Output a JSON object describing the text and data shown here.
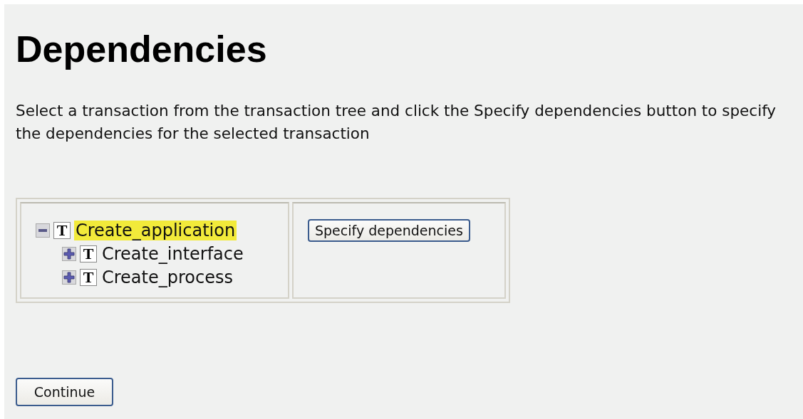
{
  "heading": "Dependencies",
  "instructions": "Select a transaction from the transaction tree and click the Specify dependencies button to specify the dependencies for the selected transaction",
  "tree": [
    {
      "label": "Create_application",
      "type_icon": "T",
      "expanded": true,
      "selected": true,
      "children": [
        {
          "label": "Create_interface",
          "type_icon": "T",
          "expanded": false,
          "selected": false
        },
        {
          "label": "Create_process",
          "type_icon": "T",
          "expanded": false,
          "selected": false
        }
      ]
    }
  ],
  "specify_button": "Specify dependencies",
  "continue_button": "Continue"
}
